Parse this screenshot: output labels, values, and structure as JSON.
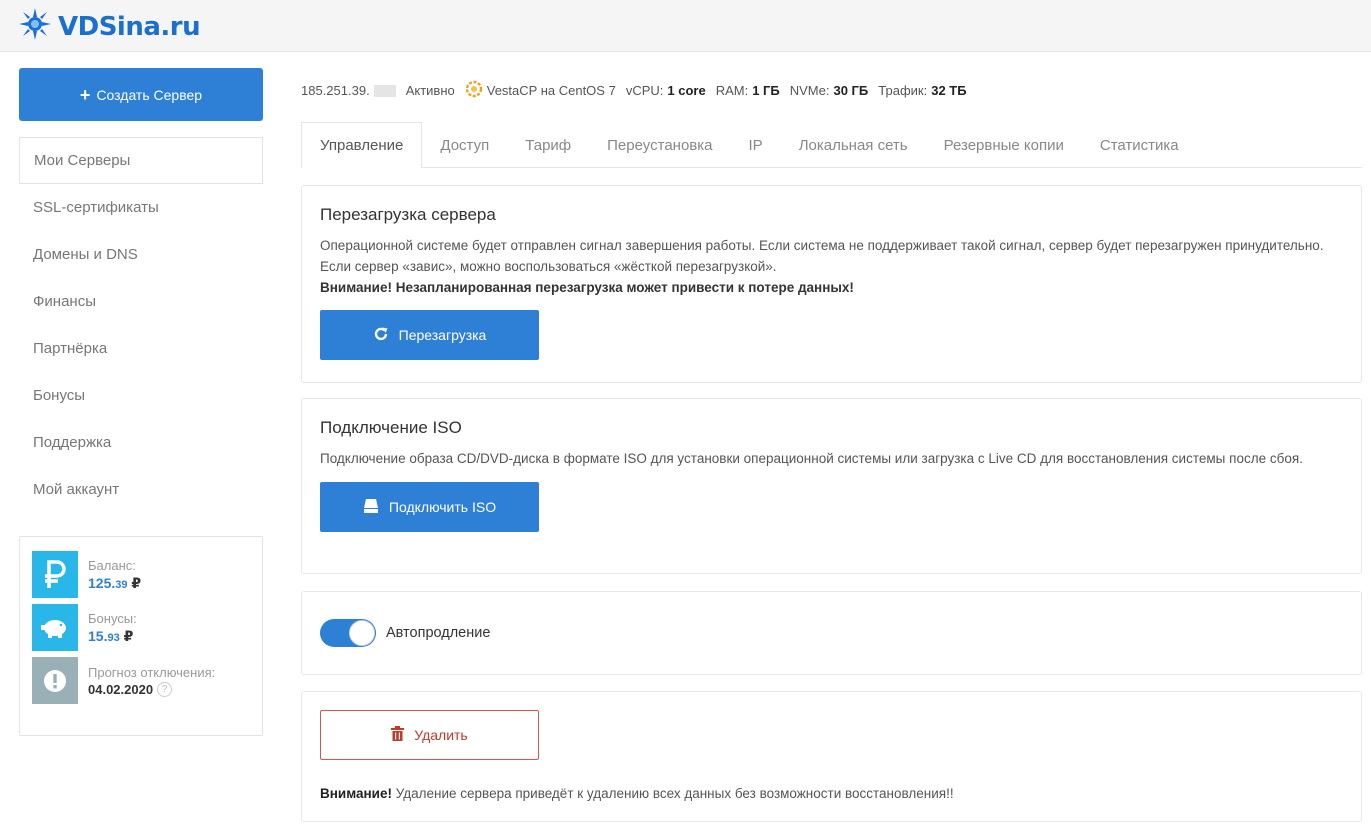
{
  "header": {
    "logo_text": "VDSina.ru"
  },
  "sidebar": {
    "create_button": "Создать Сервер",
    "nav": [
      "Мои Серверы",
      "SSL-сертификаты",
      "Домены и DNS",
      "Финансы",
      "Партнёрка",
      "Бонусы",
      "Поддержка",
      "Мой аккаунт"
    ],
    "balance_label": "Баланс:",
    "balance_int": "125.",
    "balance_dec": "39",
    "bonus_label": "Бонусы:",
    "bonus_int": "15.",
    "bonus_dec": "93",
    "currency": "₽",
    "forecast_label": "Прогноз отключения:",
    "forecast_date": "04.02.2020",
    "question_mark": "?"
  },
  "server": {
    "ip": "185.251.39.",
    "status": "Активно",
    "os": "VestaCP на CentOS 7",
    "vcpu_label": "vCPU:",
    "vcpu_value": "1 core",
    "ram_label": "RAM:",
    "ram_value": "1 ГБ",
    "disk_label": "NVMe:",
    "disk_value": "30 ГБ",
    "traffic_label": "Трафик:",
    "traffic_value": "32 ТБ"
  },
  "tabs": [
    "Управление",
    "Доступ",
    "Тариф",
    "Переустановка",
    "IP",
    "Локальная сеть",
    "Резервные копии",
    "Статистика"
  ],
  "reboot": {
    "title": "Перезагрузка сервера",
    "text": "Операционной системе будет отправлен сигнал завершения работы. Если система не поддерживает такой сигнал, сервер будет перезагружен принудительно. Если сервер «завис», можно воспользоваться «жёсткой перезагрузкой».",
    "warning": "Внимание! Незапланированная перезагрузка может привести к потере данных!",
    "button": "Перезагрузка"
  },
  "iso": {
    "title": "Подключение ISO",
    "text": "Подключение образа CD/DVD-диска в формате ISO для установки операционной системы или загрузка с Live CD для восстановления системы после сбоя.",
    "button": "Подключить ISO"
  },
  "autorenew": {
    "label": "Автопродление",
    "enabled": true
  },
  "delete": {
    "button": "Удалить",
    "warning_bold": "Внимание!",
    "warning_text": " Удаление сервера приведёт к удалению всех данных без возможности восстановления!!"
  },
  "colors": {
    "accent": "#2e80d6",
    "danger": "#d9534f",
    "balance_icon": "#29b6e8"
  },
  "icons": [
    "sunflower-logo-icon",
    "plus-icon",
    "ruble-icon",
    "piggy-bank-icon",
    "exclamation-icon",
    "question-icon",
    "vestacp-icon",
    "refresh-icon",
    "disk-icon",
    "trash-icon"
  ]
}
